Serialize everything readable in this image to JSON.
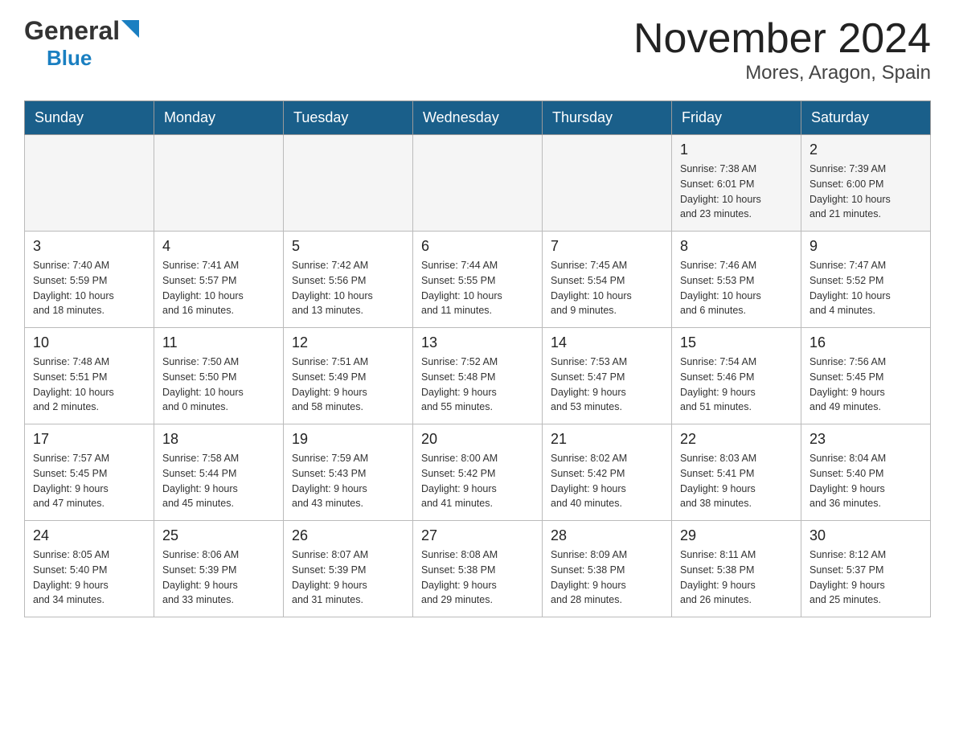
{
  "logo": {
    "general": "General",
    "triangle": "▶",
    "blue": "Blue"
  },
  "title": "November 2024",
  "subtitle": "Mores, Aragon, Spain",
  "weekdays": [
    "Sunday",
    "Monday",
    "Tuesday",
    "Wednesday",
    "Thursday",
    "Friday",
    "Saturday"
  ],
  "weeks": [
    [
      {
        "day": "",
        "info": ""
      },
      {
        "day": "",
        "info": ""
      },
      {
        "day": "",
        "info": ""
      },
      {
        "day": "",
        "info": ""
      },
      {
        "day": "",
        "info": ""
      },
      {
        "day": "1",
        "info": "Sunrise: 7:38 AM\nSunset: 6:01 PM\nDaylight: 10 hours\nand 23 minutes."
      },
      {
        "day": "2",
        "info": "Sunrise: 7:39 AM\nSunset: 6:00 PM\nDaylight: 10 hours\nand 21 minutes."
      }
    ],
    [
      {
        "day": "3",
        "info": "Sunrise: 7:40 AM\nSunset: 5:59 PM\nDaylight: 10 hours\nand 18 minutes."
      },
      {
        "day": "4",
        "info": "Sunrise: 7:41 AM\nSunset: 5:57 PM\nDaylight: 10 hours\nand 16 minutes."
      },
      {
        "day": "5",
        "info": "Sunrise: 7:42 AM\nSunset: 5:56 PM\nDaylight: 10 hours\nand 13 minutes."
      },
      {
        "day": "6",
        "info": "Sunrise: 7:44 AM\nSunset: 5:55 PM\nDaylight: 10 hours\nand 11 minutes."
      },
      {
        "day": "7",
        "info": "Sunrise: 7:45 AM\nSunset: 5:54 PM\nDaylight: 10 hours\nand 9 minutes."
      },
      {
        "day": "8",
        "info": "Sunrise: 7:46 AM\nSunset: 5:53 PM\nDaylight: 10 hours\nand 6 minutes."
      },
      {
        "day": "9",
        "info": "Sunrise: 7:47 AM\nSunset: 5:52 PM\nDaylight: 10 hours\nand 4 minutes."
      }
    ],
    [
      {
        "day": "10",
        "info": "Sunrise: 7:48 AM\nSunset: 5:51 PM\nDaylight: 10 hours\nand 2 minutes."
      },
      {
        "day": "11",
        "info": "Sunrise: 7:50 AM\nSunset: 5:50 PM\nDaylight: 10 hours\nand 0 minutes."
      },
      {
        "day": "12",
        "info": "Sunrise: 7:51 AM\nSunset: 5:49 PM\nDaylight: 9 hours\nand 58 minutes."
      },
      {
        "day": "13",
        "info": "Sunrise: 7:52 AM\nSunset: 5:48 PM\nDaylight: 9 hours\nand 55 minutes."
      },
      {
        "day": "14",
        "info": "Sunrise: 7:53 AM\nSunset: 5:47 PM\nDaylight: 9 hours\nand 53 minutes."
      },
      {
        "day": "15",
        "info": "Sunrise: 7:54 AM\nSunset: 5:46 PM\nDaylight: 9 hours\nand 51 minutes."
      },
      {
        "day": "16",
        "info": "Sunrise: 7:56 AM\nSunset: 5:45 PM\nDaylight: 9 hours\nand 49 minutes."
      }
    ],
    [
      {
        "day": "17",
        "info": "Sunrise: 7:57 AM\nSunset: 5:45 PM\nDaylight: 9 hours\nand 47 minutes."
      },
      {
        "day": "18",
        "info": "Sunrise: 7:58 AM\nSunset: 5:44 PM\nDaylight: 9 hours\nand 45 minutes."
      },
      {
        "day": "19",
        "info": "Sunrise: 7:59 AM\nSunset: 5:43 PM\nDaylight: 9 hours\nand 43 minutes."
      },
      {
        "day": "20",
        "info": "Sunrise: 8:00 AM\nSunset: 5:42 PM\nDaylight: 9 hours\nand 41 minutes."
      },
      {
        "day": "21",
        "info": "Sunrise: 8:02 AM\nSunset: 5:42 PM\nDaylight: 9 hours\nand 40 minutes."
      },
      {
        "day": "22",
        "info": "Sunrise: 8:03 AM\nSunset: 5:41 PM\nDaylight: 9 hours\nand 38 minutes."
      },
      {
        "day": "23",
        "info": "Sunrise: 8:04 AM\nSunset: 5:40 PM\nDaylight: 9 hours\nand 36 minutes."
      }
    ],
    [
      {
        "day": "24",
        "info": "Sunrise: 8:05 AM\nSunset: 5:40 PM\nDaylight: 9 hours\nand 34 minutes."
      },
      {
        "day": "25",
        "info": "Sunrise: 8:06 AM\nSunset: 5:39 PM\nDaylight: 9 hours\nand 33 minutes."
      },
      {
        "day": "26",
        "info": "Sunrise: 8:07 AM\nSunset: 5:39 PM\nDaylight: 9 hours\nand 31 minutes."
      },
      {
        "day": "27",
        "info": "Sunrise: 8:08 AM\nSunset: 5:38 PM\nDaylight: 9 hours\nand 29 minutes."
      },
      {
        "day": "28",
        "info": "Sunrise: 8:09 AM\nSunset: 5:38 PM\nDaylight: 9 hours\nand 28 minutes."
      },
      {
        "day": "29",
        "info": "Sunrise: 8:11 AM\nSunset: 5:38 PM\nDaylight: 9 hours\nand 26 minutes."
      },
      {
        "day": "30",
        "info": "Sunrise: 8:12 AM\nSunset: 5:37 PM\nDaylight: 9 hours\nand 25 minutes."
      }
    ]
  ]
}
